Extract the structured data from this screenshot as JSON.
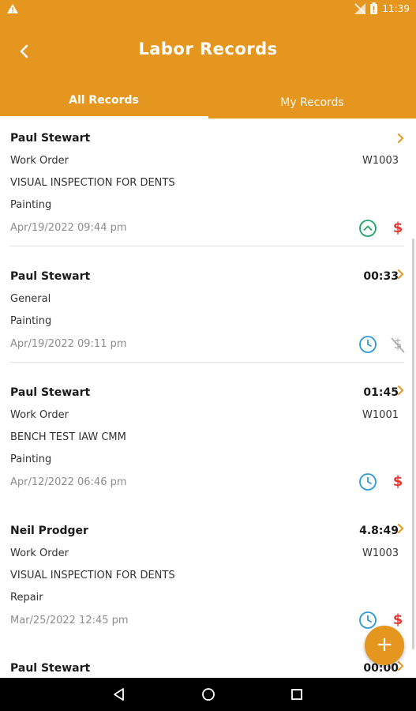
{
  "status_bar": {
    "time": "11:39",
    "icons": [
      "warning-icon",
      "no-sim-icon",
      "battery-icon"
    ]
  },
  "header": {
    "title": "Labor Records",
    "back_icon": "chevron-left-icon"
  },
  "tabs": [
    {
      "label": "All Records",
      "selected": true
    },
    {
      "label": "My Records",
      "selected": false
    }
  ],
  "colors": {
    "primary": "#E5961F",
    "green": "#1fa463",
    "blue": "#2b9bd8",
    "red": "#e53935",
    "gray": "#a8a8a8"
  },
  "records": [
    {
      "name": "Paul Stewart",
      "duration": "",
      "type": "Work Order",
      "order": "W1003",
      "description": "VISUAL INSPECTION FOR DENTS",
      "category": "Painting",
      "date": "Apr/19/2022 09:44 pm",
      "status_icon": "chevron-up-circle-icon",
      "billing_icon": "dollar-icon"
    },
    {
      "name": "Paul Stewart",
      "duration": "00:33",
      "type": "General",
      "order": "",
      "description": "",
      "category": "Painting",
      "date": "Apr/19/2022 09:11 pm",
      "status_icon": "clock-icon",
      "billing_icon": "dollar-off-icon"
    },
    {
      "name": "Paul Stewart",
      "duration": "01:45",
      "type": "Work Order",
      "order": "W1001",
      "description": "BENCH TEST IAW CMM",
      "category": "Painting",
      "date": "Apr/12/2022 06:46 pm",
      "status_icon": "clock-icon",
      "billing_icon": "dollar-icon"
    },
    {
      "name": "Neil Prodger",
      "duration": "4.8:49",
      "type": "Work Order",
      "order": "W1003",
      "description": "VISUAL INSPECTION FOR DENTS",
      "category": "Repair",
      "date": "Mar/25/2022 12:45 pm",
      "status_icon": "clock-icon",
      "billing_icon": "dollar-icon"
    },
    {
      "name": "Paul Stewart",
      "duration": "00:00"
    }
  ],
  "fab": {
    "label": "+"
  },
  "nav": [
    "back-nav-icon",
    "home-nav-icon",
    "recents-nav-icon"
  ]
}
